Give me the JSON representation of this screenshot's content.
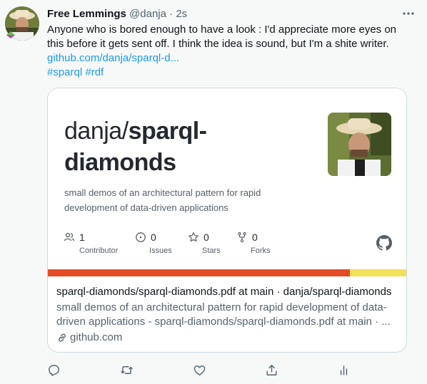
{
  "tweet": {
    "author_name": "Free Lemmings",
    "handle": "@danja",
    "separator": " · ",
    "time": "2s",
    "more_icon": "more-horizontal-icon",
    "text": "Anyone who is bored enough to have a look : I'd appreciate more eyes on this before it gets sent off. I think the idea is sound, but I'm a shite writer.",
    "link": "github.com/danja/sparql-d...",
    "hashtags": [
      "#sparql",
      "#rdf"
    ]
  },
  "card": {
    "image": {
      "owner": "danja/",
      "repo_line1": "sparql-",
      "repo_line2": "diamonds",
      "description": "small demos of an architectural pattern for rapid development of data-driven applications",
      "stats": [
        {
          "icon": "people-icon",
          "value": "1",
          "label": "Contributor"
        },
        {
          "icon": "issue-icon",
          "value": "0",
          "label": "Issues"
        },
        {
          "icon": "star-icon",
          "value": "0",
          "label": "Stars"
        },
        {
          "icon": "fork-icon",
          "value": "0",
          "label": "Forks"
        }
      ],
      "languages": [
        {
          "color": "#e34c26",
          "share": 0.84
        },
        {
          "color": "#f1e05a",
          "share": 0.16
        }
      ]
    },
    "title": "sparql-diamonds/sparql-diamonds.pdf at main · danja/sparql-diamonds",
    "description": "small demos of an architectural pattern for rapid development of data-driven applications - sparql-diamonds/sparql-diamonds.pdf at main · ...",
    "domain": "github.com"
  },
  "actions": [
    {
      "name": "reply-button",
      "icon": "reply-icon"
    },
    {
      "name": "retweet-button",
      "icon": "retweet-icon"
    },
    {
      "name": "like-button",
      "icon": "heart-icon"
    },
    {
      "name": "share-button",
      "icon": "share-icon"
    },
    {
      "name": "analytics-button",
      "icon": "analytics-icon"
    }
  ],
  "colors": {
    "accent": "#1d9bf0",
    "text": "#0f1419",
    "muted": "#536471"
  }
}
